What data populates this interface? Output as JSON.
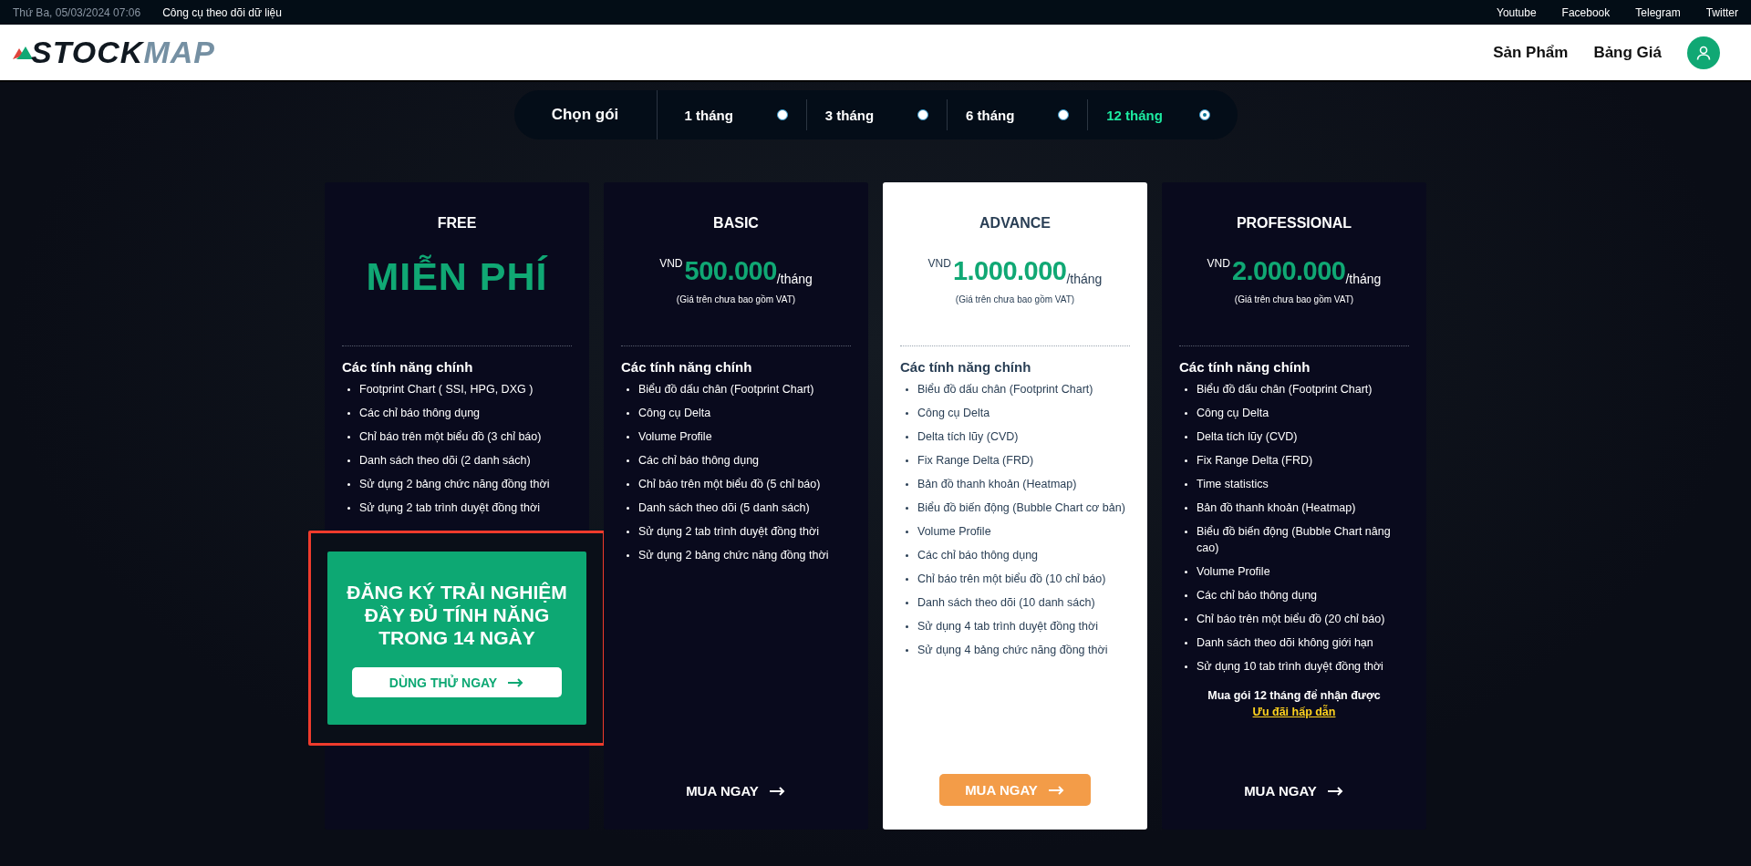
{
  "top_bar": {
    "datetime": "Thứ Ba, 05/03/2024 07:06",
    "tagline": "Công cụ theo dõi dữ liệu",
    "links": [
      "Youtube",
      "Facebook",
      "Telegram",
      "Twitter"
    ]
  },
  "header": {
    "logo": [
      "STOCK",
      "MAP"
    ],
    "nav": [
      "Sản Phẩm",
      "Bảng Giá"
    ]
  },
  "period": {
    "label": "Chọn gói",
    "options": [
      {
        "label": "1 tháng",
        "selected": false
      },
      {
        "label": "3 tháng",
        "selected": false
      },
      {
        "label": "6 tháng",
        "selected": false
      },
      {
        "label": "12 tháng",
        "selected": true
      }
    ]
  },
  "plans": [
    {
      "kind": "free",
      "name": "FREE",
      "highlighted": false,
      "price_text": "MIỄN PHÍ",
      "features_title": "Các tính năng chính",
      "features": [
        "Footprint Chart ( SSI, HPG, DXG )",
        "Các chỉ báo thông dụng",
        "Chỉ báo trên một biểu đồ (3 chỉ báo)",
        "Danh sách theo dõi (2 danh sách)",
        "Sử dụng 2 bảng chức năng đồng thời",
        "Sử dụng 2 tab trình duyệt đồng thời"
      ],
      "promo": {
        "title": "ĐĂNG KÝ TRẢI NGHIỆM ĐẦY ĐỦ TÍNH NĂNG TRONG 14 NGÀY",
        "button": "DÙNG THỬ NGAY",
        "outlined": true
      }
    },
    {
      "kind": "paid",
      "name": "BASIC",
      "highlighted": false,
      "currency": "VND",
      "amount": "500.000",
      "unit": "/tháng",
      "note": "(Giá trên chưa bao gồm VAT)",
      "features_title": "Các tính năng chính",
      "features": [
        "Biểu đồ dấu chân (Footprint Chart)",
        "Công cụ Delta",
        "Volume Profile",
        "Các chỉ báo thông dụng",
        "Chỉ báo trên một biểu đồ (5 chỉ báo)",
        "Danh sách theo dõi (5 danh sách)",
        "Sử dụng 2 tab trình duyệt đồng thời",
        "Sử dụng 2 bảng chức năng đồng thời"
      ],
      "button": "MUA NGAY"
    },
    {
      "kind": "paid",
      "name": "ADVANCE",
      "highlighted": true,
      "currency": "VND",
      "amount": "1.000.000",
      "unit": "/tháng",
      "note": "(Giá trên chưa bao gồm VAT)",
      "features_title": "Các tính năng chính",
      "features": [
        "Biểu đồ dấu chân (Footprint Chart)",
        "Công cụ Delta",
        "Delta tích lũy (CVD)",
        "Fix Range Delta (FRD)",
        "Bản đồ thanh khoản (Heatmap)",
        "Biểu đồ biến động (Bubble Chart cơ bản)",
        "Volume Profile",
        "Các chỉ báo thông dụng",
        "Chỉ báo trên một biểu đồ (10 chỉ báo)",
        "Danh sách theo dõi (10 danh sách)",
        "Sử dụng 4 tab trình duyệt đồng thời",
        "Sử dụng 4 bảng chức năng đồng thời"
      ],
      "button": "MUA NGAY"
    },
    {
      "kind": "paid",
      "name": "PROFESSIONAL",
      "highlighted": false,
      "currency": "VND",
      "amount": "2.000.000",
      "unit": "/tháng",
      "note": "(Giá trên chưa bao gồm VAT)",
      "features_title": "Các tính năng chính",
      "features": [
        "Biểu đồ dấu chân (Footprint Chart)",
        "Công cụ Delta",
        "Delta tích lũy (CVD)",
        "Fix Range Delta (FRD)",
        "Time statistics",
        "Bản đồ thanh khoản (Heatmap)",
        "Biểu đồ biến động (Bubble Chart nâng cao)",
        "Volume Profile",
        "Các chỉ báo thông dụng",
        "Chỉ báo trên một biểu đồ (20 chỉ báo)",
        "Danh sách theo dõi không giới hạn",
        "Sử dụng 10 tab trình duyệt đồng thời"
      ],
      "offer": {
        "text": "Mua gói 12 tháng để nhận được",
        "link": "Ưu đãi hấp dẫn"
      },
      "button": "MUA NGAY"
    }
  ]
}
